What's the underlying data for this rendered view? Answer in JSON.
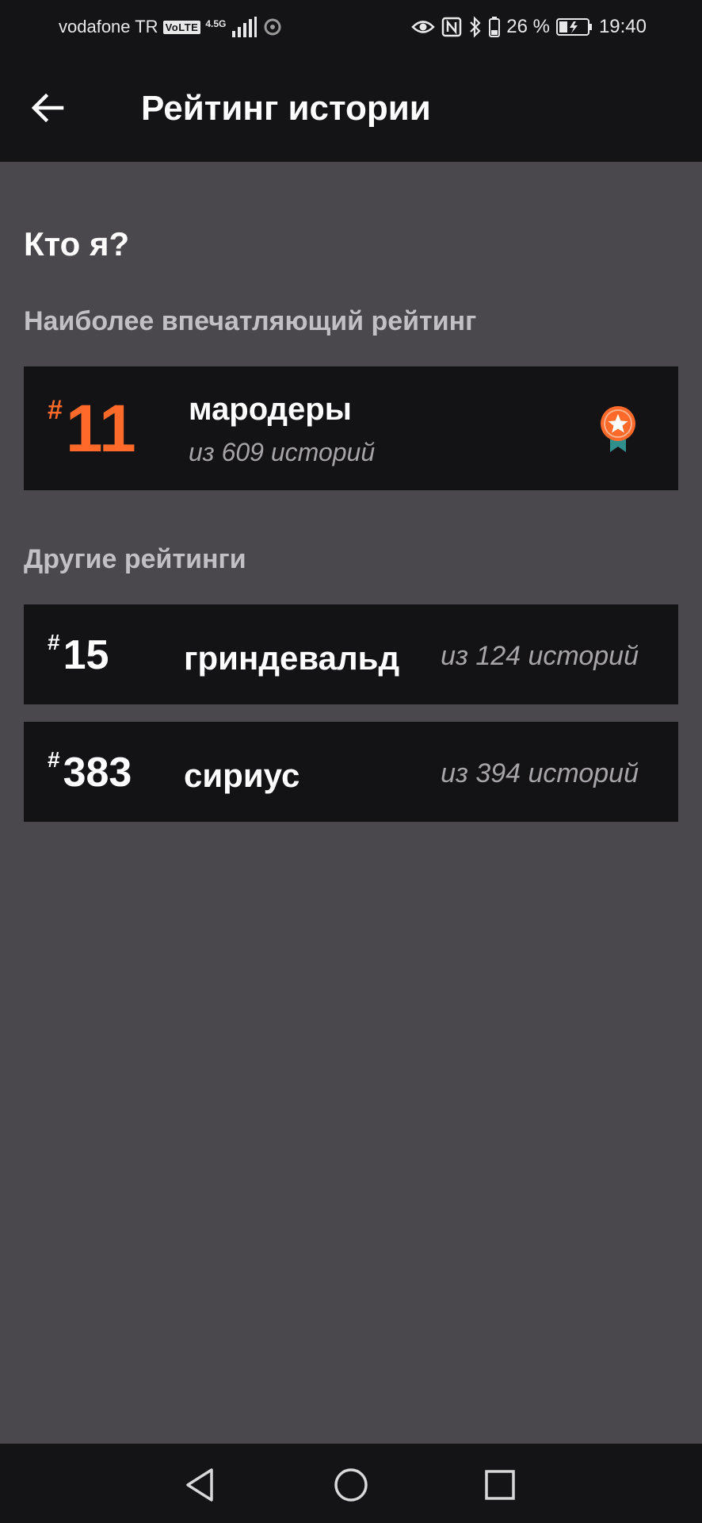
{
  "status_bar": {
    "carrier": "vodafone TR",
    "volte": "VoLTE",
    "network": "4.5G",
    "battery": "26 %",
    "time": "19:40"
  },
  "app_bar": {
    "title": "Рейтинг истории",
    "back_icon": "arrow-left-icon"
  },
  "main": {
    "heading": "Кто я?",
    "featured_heading": "Наиболее впечатляющий рейтинг",
    "featured": {
      "hash": "#",
      "rank": "11",
      "name": "мародеры",
      "subtitle": "из 609 историй",
      "icon": "award-ribbon-icon"
    },
    "others_heading": "Другие рейтинги",
    "others": [
      {
        "hash": "#",
        "rank": "15",
        "name": "гриндевальд",
        "subtitle": "из 124 историй"
      },
      {
        "hash": "#",
        "rank": "383",
        "name": "сириус",
        "subtitle": "из 394 историй"
      }
    ]
  },
  "colors": {
    "accent": "#ff6a2a",
    "badge_ribbon": "#2f8f8c",
    "card_bg": "#131215",
    "page_bg": "#4a484c",
    "bar_bg": "#141316"
  },
  "nav_bar": {
    "back": "triangle-back-icon",
    "home": "circle-home-icon",
    "recents": "square-recents-icon"
  }
}
